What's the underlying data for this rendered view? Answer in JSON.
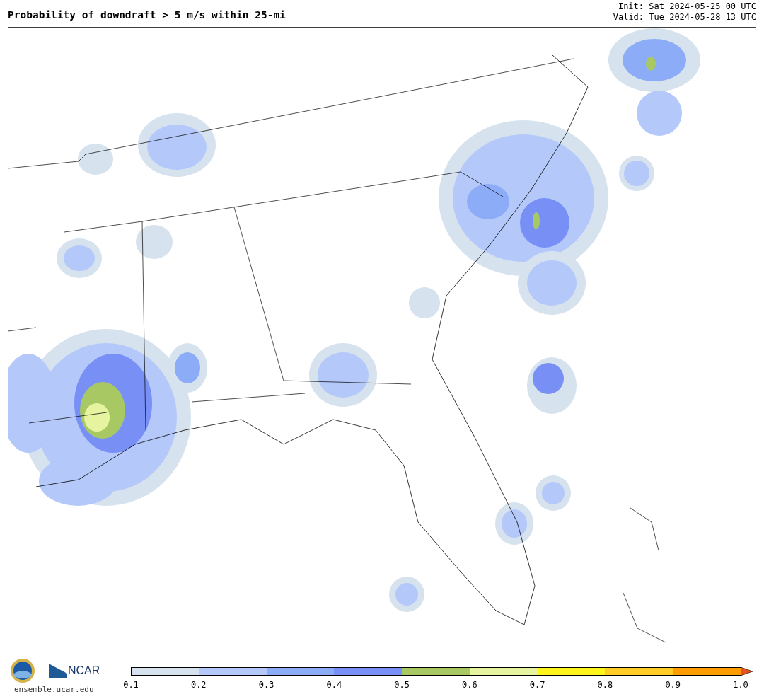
{
  "header": {
    "title": "Probability of downdraft > 5 m/s within 25-mi",
    "init": "Init: Sat 2024-05-25 00 UTC",
    "valid": "Valid: Tue 2024-05-28 13 UTC"
  },
  "footer": {
    "ncar_logo_text": "NCAR",
    "site": "ensemble.ucar.edu"
  },
  "colorbar": {
    "segments": [
      {
        "color": "#d6e2ee"
      },
      {
        "color": "#b4c8fa"
      },
      {
        "color": "#8cacf8"
      },
      {
        "color": "#7890f6"
      },
      {
        "color": "#a8c864"
      },
      {
        "color": "#e6f4a0"
      },
      {
        "color": "#fff41c"
      },
      {
        "color": "#ffcc28"
      },
      {
        "color": "#ff9c00"
      }
    ],
    "extend": {
      "color": "#e8501e"
    },
    "ticks": [
      "0.1",
      "0.2",
      "0.3",
      "0.4",
      "0.5",
      "0.6",
      "0.7",
      "0.8",
      "0.9",
      "1.0"
    ]
  }
}
